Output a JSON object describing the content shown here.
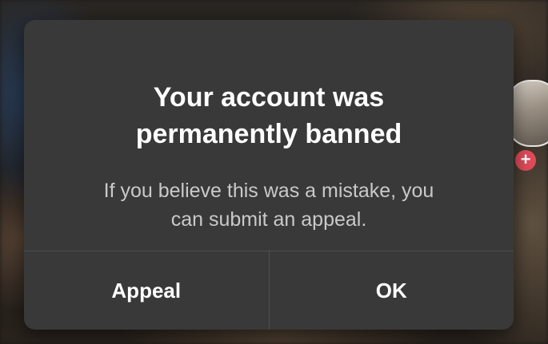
{
  "dialog": {
    "title_line1": "Your account was",
    "title_line2": "permanently banned",
    "message_line1": "If you believe this was a mistake, you",
    "message_line2": "can submit an appeal.",
    "appeal_label": "Appeal",
    "ok_label": "OK"
  },
  "background": {
    "follow_badge": "+"
  },
  "colors": {
    "dialog_bg": "#393939",
    "title": "#ffffff",
    "message": "#c9c9c9",
    "divider": "#4e4e4e",
    "follow_badge": "#e14b5a"
  }
}
